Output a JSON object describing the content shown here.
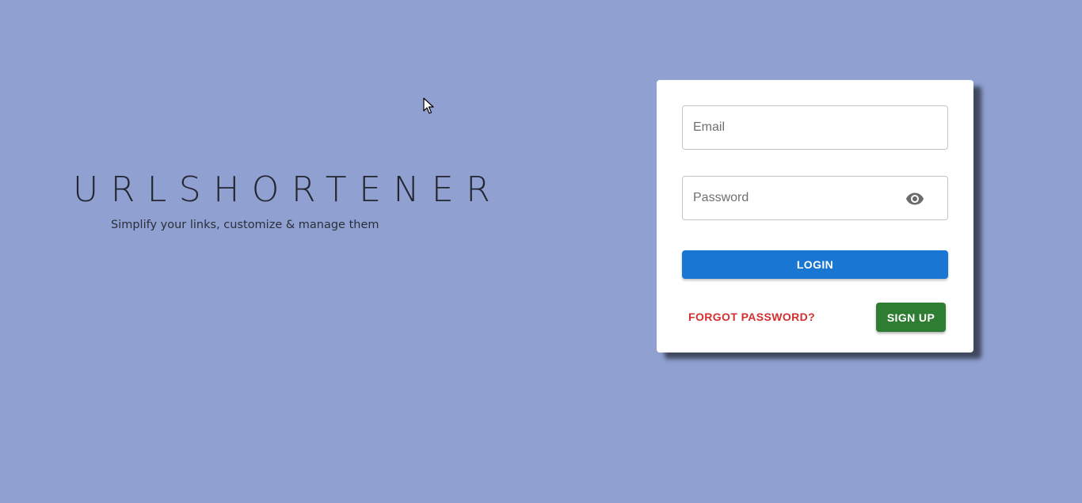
{
  "brand": {
    "title": "URLSHORTENER",
    "tagline": "Simplify your links, customize & manage them"
  },
  "login_form": {
    "email": {
      "value": "",
      "placeholder": "Email"
    },
    "password": {
      "value": "",
      "placeholder": "Password",
      "toggle_icon": "eye-icon"
    },
    "login_label": "LOGIN",
    "forgot_label": "FORGOT PASSWORD?",
    "signup_label": "SIGN UP"
  },
  "colors": {
    "background": "#8fa0d1",
    "primary": "#1976d2",
    "danger": "#d32f2f",
    "success": "#2e7d32"
  }
}
